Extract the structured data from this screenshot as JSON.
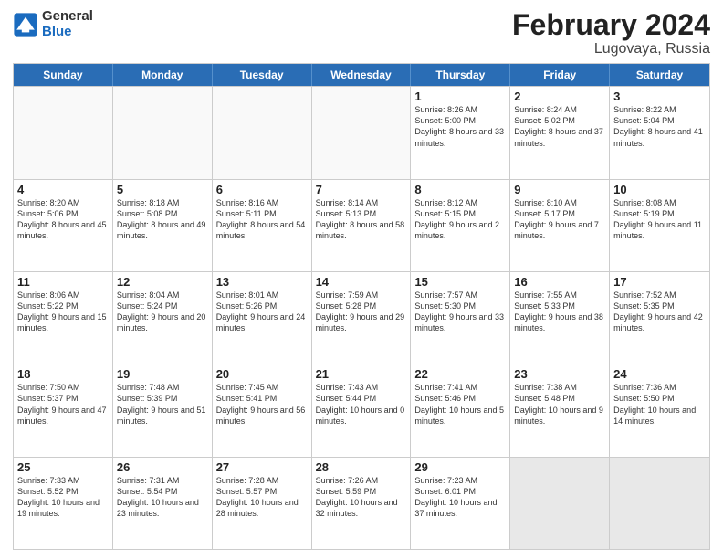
{
  "header": {
    "logo_general": "General",
    "logo_blue": "Blue",
    "title": "February 2024",
    "subtitle": "Lugovaya, Russia"
  },
  "days_of_week": [
    "Sunday",
    "Monday",
    "Tuesday",
    "Wednesday",
    "Thursday",
    "Friday",
    "Saturday"
  ],
  "weeks": [
    [
      {
        "day": "",
        "info": "",
        "empty": true
      },
      {
        "day": "",
        "info": "",
        "empty": true
      },
      {
        "day": "",
        "info": "",
        "empty": true
      },
      {
        "day": "",
        "info": "",
        "empty": true
      },
      {
        "day": "1",
        "info": "Sunrise: 8:26 AM\nSunset: 5:00 PM\nDaylight: 8 hours\nand 33 minutes."
      },
      {
        "day": "2",
        "info": "Sunrise: 8:24 AM\nSunset: 5:02 PM\nDaylight: 8 hours\nand 37 minutes."
      },
      {
        "day": "3",
        "info": "Sunrise: 8:22 AM\nSunset: 5:04 PM\nDaylight: 8 hours\nand 41 minutes."
      }
    ],
    [
      {
        "day": "4",
        "info": "Sunrise: 8:20 AM\nSunset: 5:06 PM\nDaylight: 8 hours\nand 45 minutes."
      },
      {
        "day": "5",
        "info": "Sunrise: 8:18 AM\nSunset: 5:08 PM\nDaylight: 8 hours\nand 49 minutes."
      },
      {
        "day": "6",
        "info": "Sunrise: 8:16 AM\nSunset: 5:11 PM\nDaylight: 8 hours\nand 54 minutes."
      },
      {
        "day": "7",
        "info": "Sunrise: 8:14 AM\nSunset: 5:13 PM\nDaylight: 8 hours\nand 58 minutes."
      },
      {
        "day": "8",
        "info": "Sunrise: 8:12 AM\nSunset: 5:15 PM\nDaylight: 9 hours\nand 2 minutes."
      },
      {
        "day": "9",
        "info": "Sunrise: 8:10 AM\nSunset: 5:17 PM\nDaylight: 9 hours\nand 7 minutes."
      },
      {
        "day": "10",
        "info": "Sunrise: 8:08 AM\nSunset: 5:19 PM\nDaylight: 9 hours\nand 11 minutes."
      }
    ],
    [
      {
        "day": "11",
        "info": "Sunrise: 8:06 AM\nSunset: 5:22 PM\nDaylight: 9 hours\nand 15 minutes."
      },
      {
        "day": "12",
        "info": "Sunrise: 8:04 AM\nSunset: 5:24 PM\nDaylight: 9 hours\nand 20 minutes."
      },
      {
        "day": "13",
        "info": "Sunrise: 8:01 AM\nSunset: 5:26 PM\nDaylight: 9 hours\nand 24 minutes."
      },
      {
        "day": "14",
        "info": "Sunrise: 7:59 AM\nSunset: 5:28 PM\nDaylight: 9 hours\nand 29 minutes."
      },
      {
        "day": "15",
        "info": "Sunrise: 7:57 AM\nSunset: 5:30 PM\nDaylight: 9 hours\nand 33 minutes."
      },
      {
        "day": "16",
        "info": "Sunrise: 7:55 AM\nSunset: 5:33 PM\nDaylight: 9 hours\nand 38 minutes."
      },
      {
        "day": "17",
        "info": "Sunrise: 7:52 AM\nSunset: 5:35 PM\nDaylight: 9 hours\nand 42 minutes."
      }
    ],
    [
      {
        "day": "18",
        "info": "Sunrise: 7:50 AM\nSunset: 5:37 PM\nDaylight: 9 hours\nand 47 minutes."
      },
      {
        "day": "19",
        "info": "Sunrise: 7:48 AM\nSunset: 5:39 PM\nDaylight: 9 hours\nand 51 minutes."
      },
      {
        "day": "20",
        "info": "Sunrise: 7:45 AM\nSunset: 5:41 PM\nDaylight: 9 hours\nand 56 minutes."
      },
      {
        "day": "21",
        "info": "Sunrise: 7:43 AM\nSunset: 5:44 PM\nDaylight: 10 hours\nand 0 minutes."
      },
      {
        "day": "22",
        "info": "Sunrise: 7:41 AM\nSunset: 5:46 PM\nDaylight: 10 hours\nand 5 minutes."
      },
      {
        "day": "23",
        "info": "Sunrise: 7:38 AM\nSunset: 5:48 PM\nDaylight: 10 hours\nand 9 minutes."
      },
      {
        "day": "24",
        "info": "Sunrise: 7:36 AM\nSunset: 5:50 PM\nDaylight: 10 hours\nand 14 minutes."
      }
    ],
    [
      {
        "day": "25",
        "info": "Sunrise: 7:33 AM\nSunset: 5:52 PM\nDaylight: 10 hours\nand 19 minutes."
      },
      {
        "day": "26",
        "info": "Sunrise: 7:31 AM\nSunset: 5:54 PM\nDaylight: 10 hours\nand 23 minutes."
      },
      {
        "day": "27",
        "info": "Sunrise: 7:28 AM\nSunset: 5:57 PM\nDaylight: 10 hours\nand 28 minutes."
      },
      {
        "day": "28",
        "info": "Sunrise: 7:26 AM\nSunset: 5:59 PM\nDaylight: 10 hours\nand 32 minutes."
      },
      {
        "day": "29",
        "info": "Sunrise: 7:23 AM\nSunset: 6:01 PM\nDaylight: 10 hours\nand 37 minutes."
      },
      {
        "day": "",
        "info": "",
        "empty": true,
        "shaded": true
      },
      {
        "day": "",
        "info": "",
        "empty": true,
        "shaded": true
      }
    ]
  ]
}
